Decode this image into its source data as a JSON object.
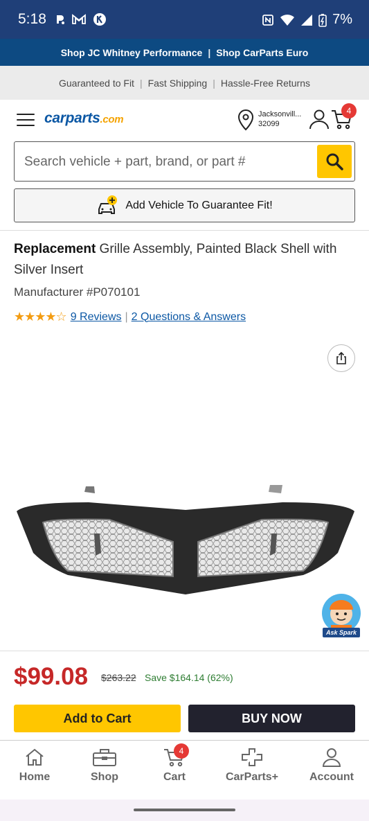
{
  "status_bar": {
    "time": "5:18",
    "battery": "7%"
  },
  "promo": {
    "link1": "Shop JC Whitney Performance",
    "separator": "|",
    "link2": "Shop CarParts Euro"
  },
  "guarantee": {
    "item1": "Guaranteed to Fit",
    "item2": "Fast Shipping",
    "item3": "Hassle-Free Returns",
    "separator": "|"
  },
  "header": {
    "logo_main": "carparts",
    "logo_suffix": ".com",
    "location_city": "Jacksonvill...",
    "location_zip": "32099",
    "cart_count": "4"
  },
  "search": {
    "placeholder": "Search vehicle + part, brand, or part #"
  },
  "vehicle": {
    "label": "Add Vehicle To Guarantee Fit!"
  },
  "product": {
    "title_bold": "Replacement",
    "title_rest": " Grille Assembly, Painted Black Shell with Silver Insert",
    "manufacturer": "Manufacturer #P070101",
    "stars": "★★★★☆",
    "reviews": "9 Reviews",
    "qa": "2 Questions & Answers",
    "rating": 4.5
  },
  "spark": {
    "label": "Ask Spark"
  },
  "pricing": {
    "price": "$99.08",
    "original": "$263.22",
    "savings": "Save $164.14 (62%)"
  },
  "actions": {
    "add_to_cart": "Add to Cart",
    "buy_now": "BUY NOW"
  },
  "nav": [
    {
      "label": "Home",
      "icon": "home-icon"
    },
    {
      "label": "Shop",
      "icon": "toolbox-icon"
    },
    {
      "label": "Cart",
      "icon": "cart-icon",
      "badge": "4"
    },
    {
      "label": "CarParts+",
      "icon": "carparts-plus-icon"
    },
    {
      "label": "Account",
      "icon": "account-icon"
    }
  ],
  "colors": {
    "brand_blue": "#0b57a4",
    "accent_yellow": "#ffc600",
    "price_red": "#c62828",
    "save_green": "#2e7d32"
  }
}
